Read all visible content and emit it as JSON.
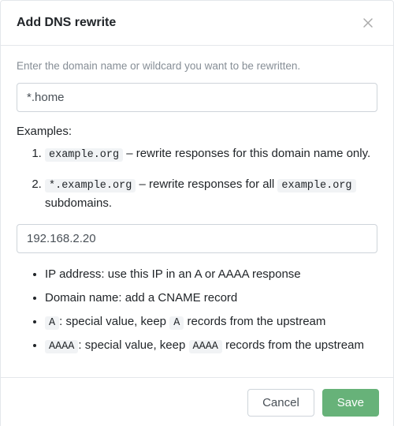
{
  "header": {
    "title": "Add DNS rewrite"
  },
  "body": {
    "intro": "Enter the domain name or wildcard you want to be rewritten.",
    "domain_value": "*.home",
    "examples_label": "Examples:",
    "example1_code": "example.org",
    "example1_text": " – rewrite responses for this domain name only.",
    "example2_code": "*.example.org",
    "example2_text_a": " – rewrite responses for all ",
    "example2_code2": "example.org",
    "example2_text_b": " subdomains.",
    "ip_value": "192.168.2.20",
    "note1": "IP address: use this IP in an A or AAAA response",
    "note2": "Domain name: add a CNAME record",
    "note3_code": "A",
    "note3_text_a": ": special value, keep ",
    "note3_code2": "A",
    "note3_text_b": " records from the upstream",
    "note4_code": "AAAA",
    "note4_text_a": ": special value, keep ",
    "note4_code2": "AAAA",
    "note4_text_b": " records from the upstream"
  },
  "footer": {
    "cancel_label": "Cancel",
    "save_label": "Save"
  }
}
